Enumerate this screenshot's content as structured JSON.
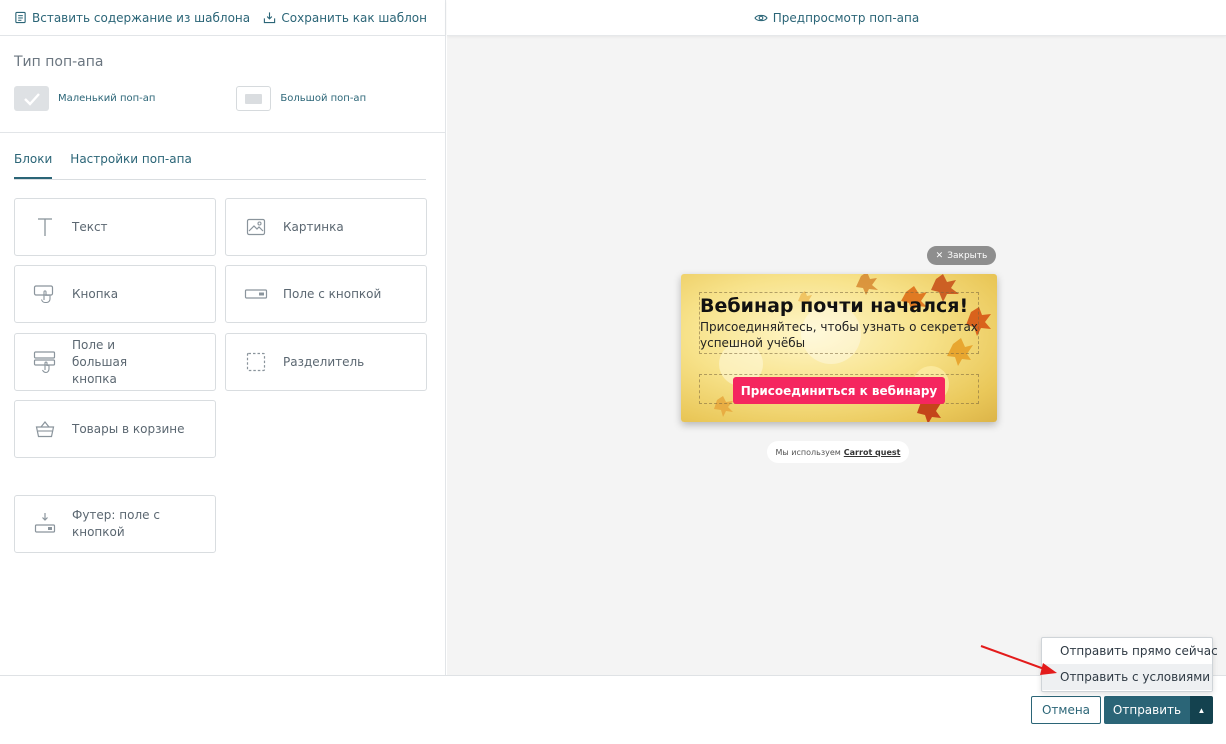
{
  "toolbar": {
    "insert_template": "Вставить содержание из шаблона",
    "save_template": "Сохранить как шаблон",
    "preview": "Предпросмотр поп-апа"
  },
  "popup_type": {
    "title": "Тип поп-апа",
    "small": "Маленький поп-ап",
    "large": "Большой поп-ап",
    "selected": "small"
  },
  "tabs": {
    "blocks": "Блоки",
    "settings": "Настройки поп-апа",
    "active": "blocks"
  },
  "blocks": [
    {
      "label": "Текст",
      "icon": "text-icon"
    },
    {
      "label": "Картинка",
      "icon": "image-icon"
    },
    {
      "label": "Кнопка",
      "icon": "button-icon"
    },
    {
      "label": "Поле с кнопкой",
      "icon": "field-button-icon"
    },
    {
      "label": "Поле и большая кнопка",
      "icon": "field-big-button-icon"
    },
    {
      "label": "Разделитель",
      "icon": "divider-icon"
    },
    {
      "label": "Товары в корзине",
      "icon": "basket-icon"
    },
    {
      "label": "Футер: поле с кнопкой",
      "icon": "footer-field-icon"
    }
  ],
  "preview_popup": {
    "close_label": "Закрыть",
    "title": "Вебинар почти начался!",
    "subtitle": "Присоединяйтесь, чтобы узнать о секретах успешной учёбы",
    "cta": "Присоединиться к вебинару",
    "credit_prefix": "Мы используем",
    "credit_brand": "Carrot quest",
    "cta_color": "#f5265f"
  },
  "footer": {
    "cancel": "Отмена",
    "send": "Отправить",
    "menu": [
      "Отправить прямо сейчас",
      "Отправить с условиями"
    ],
    "highlighted_item": 1
  },
  "colors": {
    "accent": "#2b6577",
    "accent_dark": "#14424f",
    "annotation_arrow": "#e31b1b"
  }
}
